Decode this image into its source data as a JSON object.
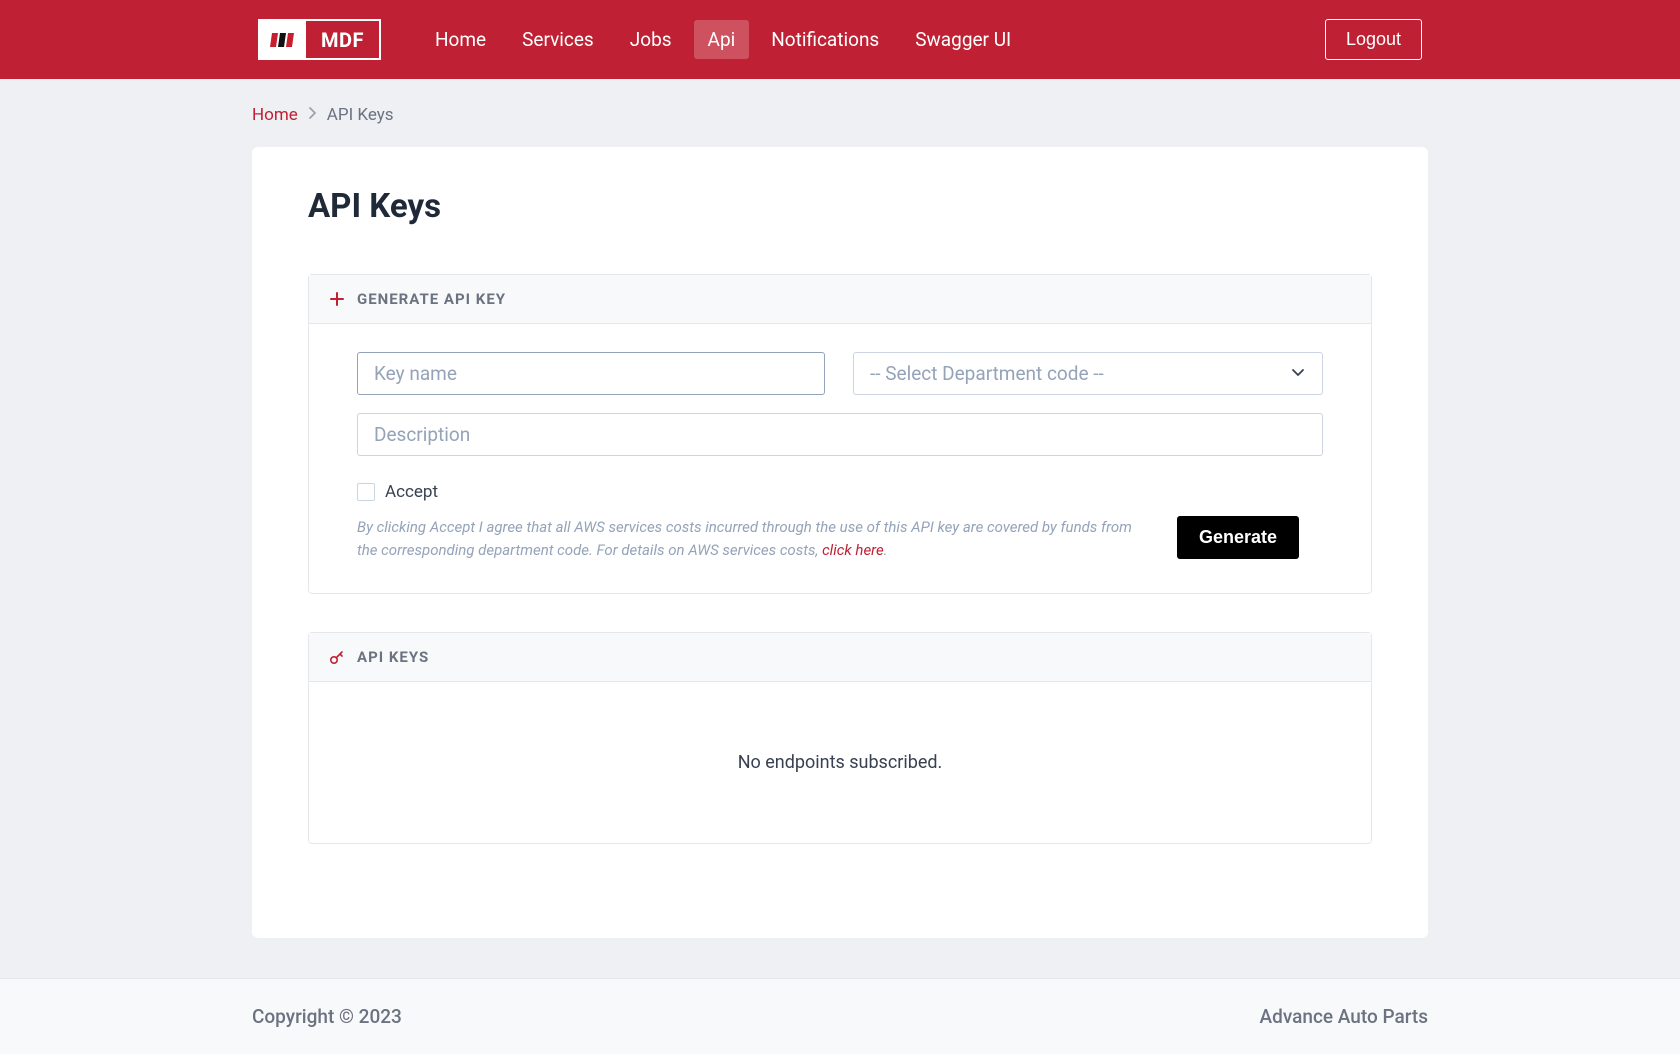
{
  "brand": {
    "name": "MDF"
  },
  "nav": {
    "items": [
      {
        "label": "Home",
        "active": false
      },
      {
        "label": "Services",
        "active": false
      },
      {
        "label": "Jobs",
        "active": false
      },
      {
        "label": "Api",
        "active": true
      },
      {
        "label": "Notifications",
        "active": false
      },
      {
        "label": "Swagger UI",
        "active": false
      }
    ]
  },
  "logout_label": "Logout",
  "breadcrumb": {
    "home": "Home",
    "current": "API Keys"
  },
  "page_title": "API Keys",
  "generate_panel": {
    "title": "GENERATE API KEY",
    "key_name_placeholder": "Key name",
    "department_placeholder": "-- Select Department code --",
    "description_placeholder": "Description",
    "accept_label": "Accept",
    "terms_prefix": "By clicking Accept I agree that all AWS services costs incurred through the use of this API key are covered by funds from the corresponding department code. For details on AWS services costs, ",
    "terms_link": "click here",
    "terms_suffix": ".",
    "generate_button": "Generate"
  },
  "keys_panel": {
    "title": "API KEYS",
    "empty_message": "No endpoints subscribed."
  },
  "footer": {
    "copyright": "Copyright © 2023",
    "company": "Advance Auto Parts"
  }
}
